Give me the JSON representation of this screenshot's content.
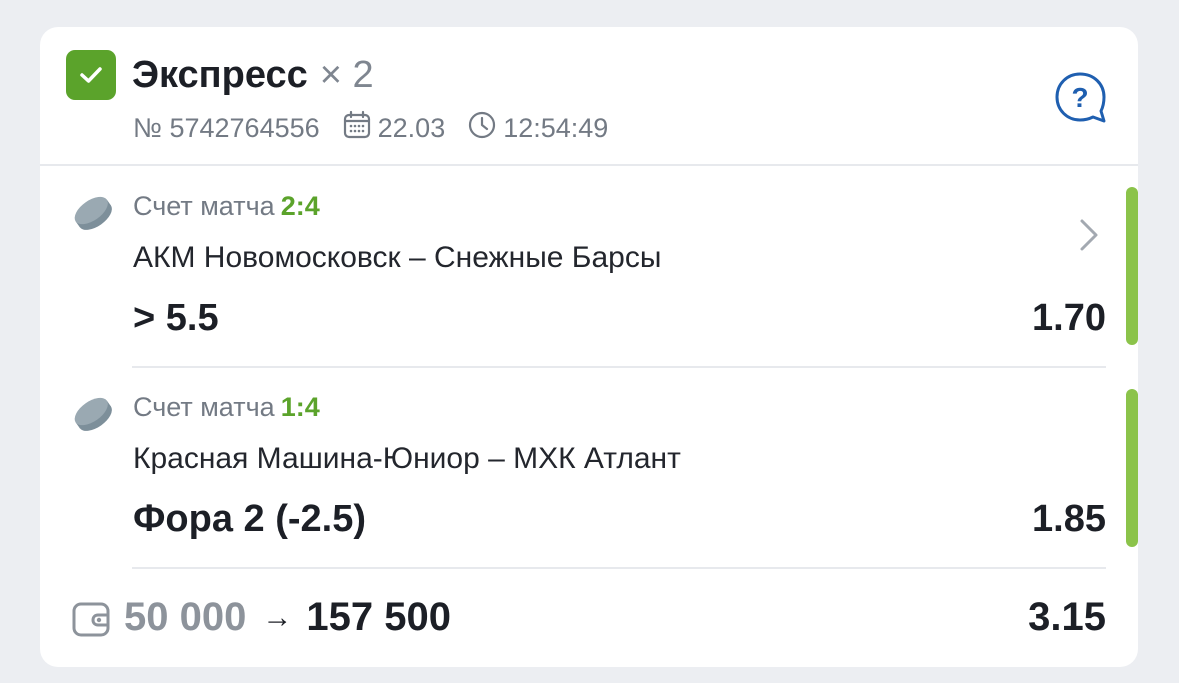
{
  "header": {
    "title": "Экспресс",
    "multiplier": "× 2",
    "ticket_number": "№ 5742764556",
    "date": "22.03",
    "time": "12:54:49",
    "check_icon": "checkbox-checked-icon",
    "calendar_icon": "calendar-icon",
    "clock_icon": "clock-icon",
    "help_icon": "help-chat-icon"
  },
  "bets": [
    {
      "score_label": "Счет матча",
      "score": "2:4",
      "match": "АКМ Новомосковск – Снежные Барсы",
      "outcome": "> 5.5",
      "odds": "1.70",
      "sport_icon": "hockey-puck-icon",
      "status_color": "#8bc34a"
    },
    {
      "score_label": "Счет матча",
      "score": "1:4",
      "match": "Красная Машина-Юниор – МХК Атлант",
      "outcome": "Фора 2 (-2.5)",
      "odds": "1.85",
      "sport_icon": "hockey-puck-icon",
      "status_color": "#8bc34a"
    }
  ],
  "footer": {
    "stake": "50 000",
    "arrow": "→",
    "payout": "157 500",
    "total_odds": "3.15",
    "wallet_icon": "wallet-icon"
  },
  "colors": {
    "accent_green": "#5ba32b",
    "win_bar": "#8bc34a",
    "help_blue": "#1f5fb0"
  }
}
